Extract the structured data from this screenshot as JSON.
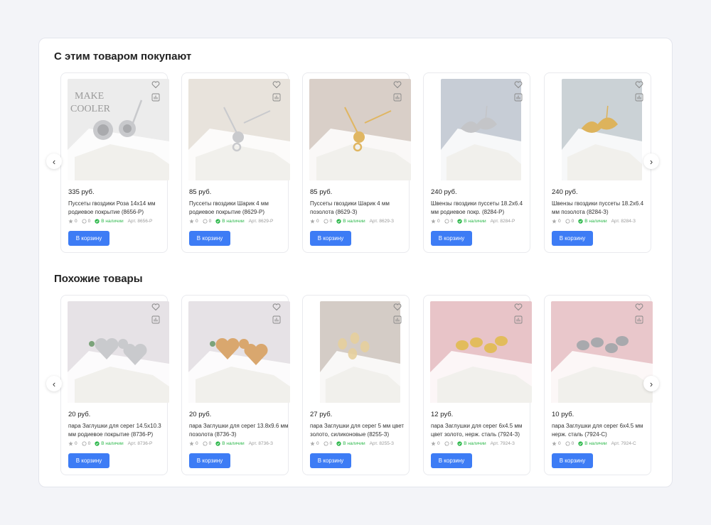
{
  "sections": [
    {
      "title": "С этим товаром покупают",
      "nav": {
        "prev": "‹",
        "next": "›"
      },
      "products": [
        {
          "price": "335 руб.",
          "name": "Пуссеты гвоздики Роза 14x14 мм родиевое покрытие (8656-Р)",
          "rating": "0",
          "comments": "0",
          "stock": "В наличии",
          "article": "Арт. 8656-Р",
          "button": "В корзину",
          "image": {
            "bg": "#ececec",
            "metal": "#c8c9cc",
            "kind": "rose"
          }
        },
        {
          "price": "85 руб.",
          "name": "Пуссеты гвоздики Шарик 4 мм родиевое покрытие (8629-Р)",
          "rating": "0",
          "comments": "0",
          "stock": "В наличии",
          "article": "Арт. 8629-Р",
          "button": "В корзину",
          "image": {
            "bg": "#e8e3dc",
            "metal": "#c9cacd",
            "kind": "ball"
          }
        },
        {
          "price": "85 руб.",
          "name": "Пуссеты гвоздики Шарик 4 мм позолота (8629-З)",
          "rating": "0",
          "comments": "0",
          "stock": "В наличии",
          "article": "Арт. 8629-З",
          "button": "В корзину",
          "image": {
            "bg": "#d9cfc8",
            "metal": "#e0b662",
            "kind": "ball"
          }
        },
        {
          "price": "240 руб.",
          "name": "Швензы гвоздики пуссеты 18.2x6.4 мм родиевое покр. (8284-Р)",
          "rating": "0",
          "comments": "0",
          "stock": "В наличии",
          "article": "Арт. 8284-Р",
          "button": "В корзину",
          "image": {
            "bg": "#c7cdd6",
            "metal": "#c4c5c8",
            "kind": "leaf",
            "narrow": true
          }
        },
        {
          "price": "240 руб.",
          "name": "Швензы гвоздики пуссеты 18.2x6.4 мм позолота (8284-З)",
          "rating": "0",
          "comments": "0",
          "stock": "В наличии",
          "article": "Арт. 8284-З",
          "button": "В корзину",
          "image": {
            "bg": "#cbd2d6",
            "metal": "#ddb35c",
            "kind": "leaf",
            "narrow": true
          }
        }
      ]
    },
    {
      "title": "Похожие товары",
      "nav": {
        "prev": "‹",
        "next": "›"
      },
      "products": [
        {
          "price": "20 руб.",
          "name": "пара Заглушки для серег 14.5x10.3 мм родиевое покрытие (8736-Р)",
          "rating": "0",
          "comments": "0",
          "stock": "В наличии",
          "article": "Арт. 8736-Р",
          "button": "В корзину",
          "image": {
            "bg": "#e6e2e6",
            "metal": "#c9cacd",
            "kind": "heart"
          }
        },
        {
          "price": "20 руб.",
          "name": "пара Заглушки для серег 13.8x9.6 мм позолота (8736-З)",
          "rating": "0",
          "comments": "0",
          "stock": "В наличии",
          "article": "Арт. 8736-З",
          "button": "В корзину",
          "image": {
            "bg": "#e6e2e6",
            "metal": "#d9a76e",
            "kind": "heart"
          }
        },
        {
          "price": "27 руб.",
          "name": "пара Заглушки для серег 5 мм цвет золото, силиконовые (8255-З)",
          "rating": "0",
          "comments": "0",
          "stock": "В наличии",
          "article": "Арт. 8255-З",
          "button": "В корзину",
          "image": {
            "bg": "#d4ccc6",
            "metal": "#e5cf9c",
            "kind": "clear",
            "narrow": true
          }
        },
        {
          "price": "12 руб.",
          "name": "пара Заглушки для серег 6x4.5 мм цвет золото, нерж. сталь (7924-З)",
          "rating": "0",
          "comments": "0",
          "stock": "В наличии",
          "article": "Арт. 7924-З",
          "button": "В корзину",
          "image": {
            "bg": "#e8c4c8",
            "metal": "#e2bc5c",
            "kind": "butterfly"
          }
        },
        {
          "price": "10 руб.",
          "name": "пара Заглушки для серег 6x4.5 мм нерж. сталь (7924-С)",
          "rating": "0",
          "comments": "0",
          "stock": "В наличии",
          "article": "Арт. 7924-С",
          "button": "В корзину",
          "image": {
            "bg": "#e9c7cb",
            "metal": "#a8a9ad",
            "kind": "butterfly"
          }
        }
      ]
    }
  ],
  "colors": {
    "accent": "#3d7cf5",
    "stock": "#2db84b"
  },
  "icons": [
    "heart-icon",
    "compare-icon",
    "star-icon",
    "comment-icon",
    "check-circle-icon",
    "chevron-left-icon",
    "chevron-right-icon"
  ]
}
